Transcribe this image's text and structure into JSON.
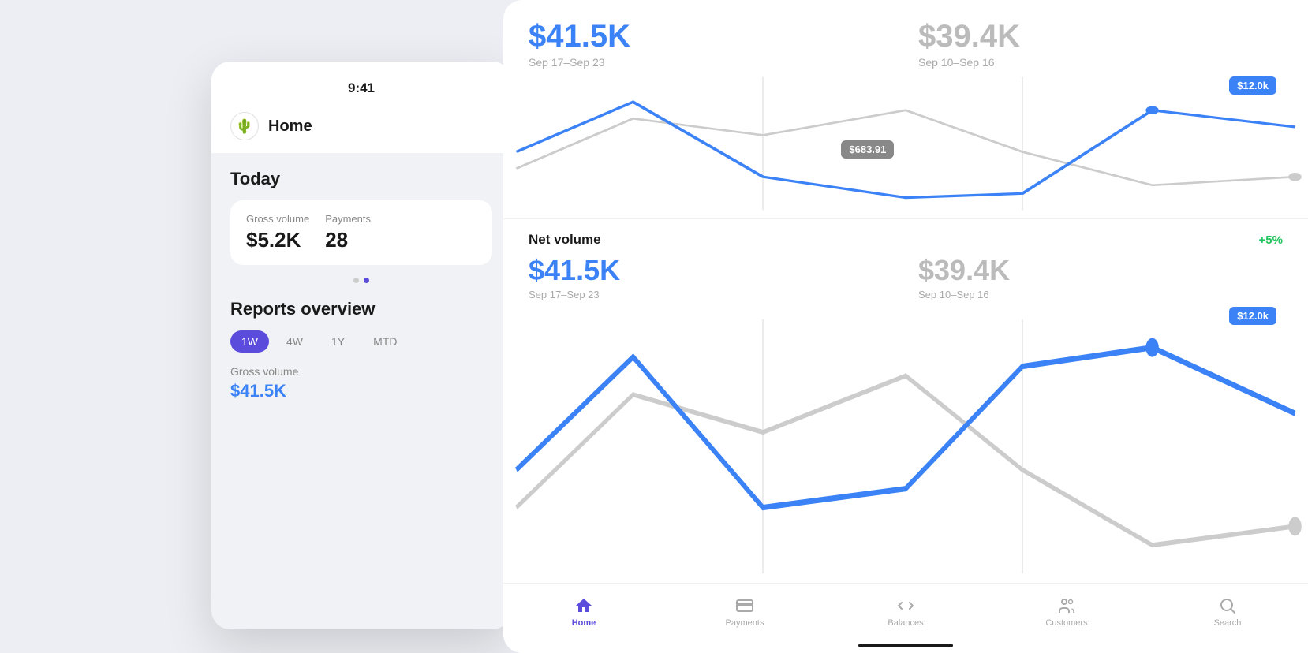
{
  "background": {
    "color": "#eceef3"
  },
  "mobile": {
    "time": "9:41",
    "app_icon": "🌵",
    "nav_title": "Home",
    "today_label": "Today",
    "stats": {
      "gross_volume_label": "Gross volume",
      "gross_volume_value": "$5.2K",
      "payments_label": "Payments",
      "payments_value": "28"
    },
    "pagination": {
      "dots": [
        false,
        true
      ]
    },
    "reports_overview_label": "Reports overview",
    "time_filters": [
      "1W",
      "4W",
      "1Y",
      "MTD"
    ],
    "active_filter": "1W",
    "gross_volume_label2": "Gross volume",
    "gross_volume_value2": "$41.5K"
  },
  "panel": {
    "top": {
      "current_value": "$41.5K",
      "current_date": "Sep 17–Sep 23",
      "previous_value": "$39.4K",
      "previous_date": "Sep 10–Sep 16",
      "tooltip_blue": "$12.0k",
      "tooltip_gray": "$683.91"
    },
    "net_volume": {
      "label": "Net volume",
      "change": "+5%",
      "current_value": "$41.5K",
      "current_date": "Sep 17–Sep 23",
      "previous_value": "$39.4K",
      "previous_date": "Sep 10–Sep 16",
      "tooltip_blue": "$12.0k"
    },
    "tabs": [
      {
        "id": "home",
        "label": "Home",
        "icon": "🏠",
        "active": true
      },
      {
        "id": "payments",
        "label": "Payments",
        "icon": "💳",
        "active": false
      },
      {
        "id": "balances",
        "label": "Balances",
        "icon": "⇅",
        "active": false
      },
      {
        "id": "customers",
        "label": "Customers",
        "icon": "👥",
        "active": false
      },
      {
        "id": "search",
        "label": "Search",
        "icon": "🔍",
        "active": false
      }
    ]
  }
}
